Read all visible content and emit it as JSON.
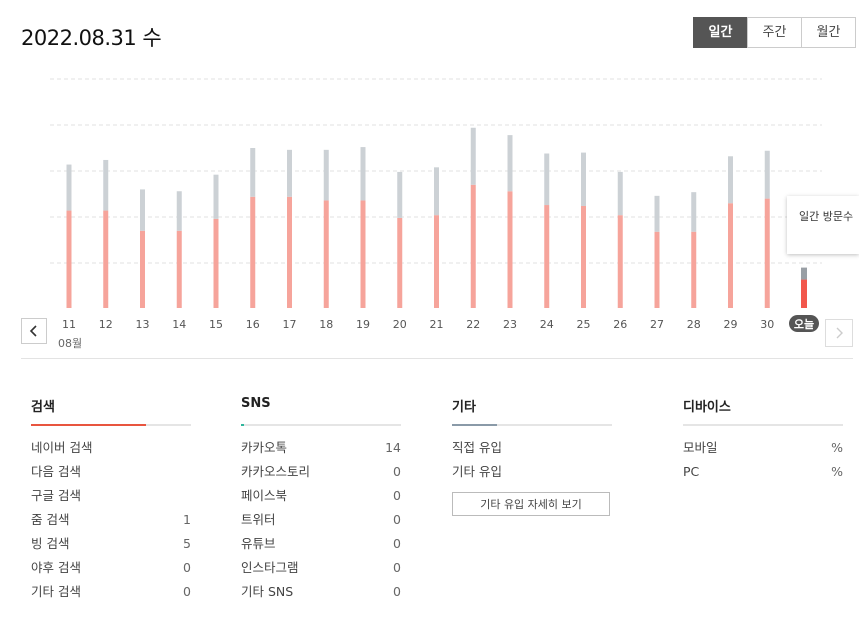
{
  "header": {
    "date": "2022.08.31 수"
  },
  "period_tabs": [
    {
      "label": "일간",
      "active": true
    },
    {
      "label": "주간",
      "active": false
    },
    {
      "label": "월간",
      "active": false
    }
  ],
  "chart_data": {
    "type": "bar",
    "categories": [
      "11",
      "12",
      "13",
      "14",
      "15",
      "16",
      "17",
      "18",
      "19",
      "20",
      "21",
      "22",
      "23",
      "24",
      "25",
      "26",
      "27",
      "28",
      "29",
      "30",
      "오늘"
    ],
    "series": [
      {
        "values": [
          107,
          107,
          85,
          85,
          98,
          122,
          122,
          118,
          118,
          99,
          102,
          135,
          128,
          113,
          112,
          102,
          84,
          84,
          115,
          120,
          32
        ],
        "color": "#f6a49b",
        "today_color": "#f2574c"
      },
      {
        "values": [
          50,
          55,
          45,
          43,
          48,
          53,
          51,
          55,
          58,
          50,
          52,
          62,
          61,
          56,
          58,
          47,
          39,
          43,
          51,
          52,
          13
        ],
        "color": "#ccd1d5",
        "today_color": "#999fa5"
      }
    ],
    "stacked": true,
    "ylim": [
      0,
      250
    ],
    "grid": true,
    "month_label": "08월",
    "tooltip": "일간 방문수"
  },
  "sections": [
    {
      "title": "검색",
      "accent": "#e8553f",
      "accent_ratio": 0.72,
      "items": [
        {
          "label": "네이버 검색",
          "value": ""
        },
        {
          "label": "다음 검색",
          "value": ""
        },
        {
          "label": "구글 검색",
          "value": ""
        },
        {
          "label": "줌 검색",
          "value": "1"
        },
        {
          "label": "빙 검색",
          "value": "5"
        },
        {
          "label": "야후 검색",
          "value": "0"
        },
        {
          "label": "기타 검색",
          "value": "0"
        }
      ]
    },
    {
      "title": "SNS",
      "accent": "#2fb59c",
      "accent_ratio": 0.02,
      "items": [
        {
          "label": "카카오톡",
          "value": "14"
        },
        {
          "label": "카카오스토리",
          "value": "0"
        },
        {
          "label": "페이스북",
          "value": "0"
        },
        {
          "label": "트위터",
          "value": "0"
        },
        {
          "label": "유튜브",
          "value": "0"
        },
        {
          "label": "인스타그램",
          "value": "0"
        },
        {
          "label": "기타 SNS",
          "value": "0"
        }
      ]
    },
    {
      "title": "기타",
      "accent": "#8a9aa8",
      "accent_ratio": 0.28,
      "items": [
        {
          "label": "직접 유입",
          "value": ""
        },
        {
          "label": "기타 유입",
          "value": ""
        }
      ],
      "button": "기타 유입 자세히 보기"
    },
    {
      "title": "디바이스",
      "accent": "#e5e5e5",
      "accent_ratio": 0,
      "items": [
        {
          "label": "모바일",
          "value": "%"
        },
        {
          "label": "PC",
          "value": "%"
        }
      ]
    }
  ]
}
